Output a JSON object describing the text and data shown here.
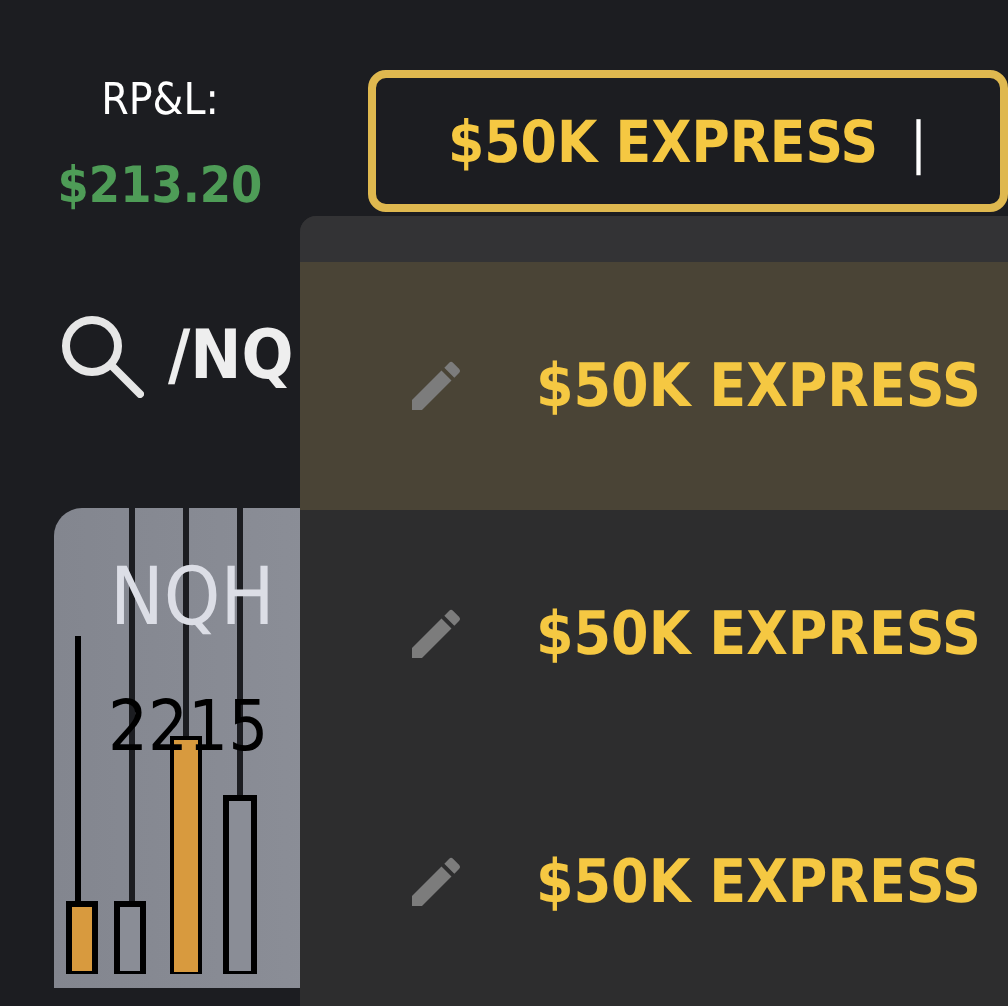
{
  "pnl": {
    "label": "RP&L:",
    "value": "$213.20"
  },
  "account_button": {
    "label": "$50K EXPRESS",
    "separator": "|"
  },
  "search": {
    "value": "/NQ"
  },
  "card": {
    "symbol": "NQH",
    "price": "2215"
  },
  "account_menu": [
    {
      "label": "$50K EXPRESS",
      "selected": true
    },
    {
      "label": "$50K EXPRESS",
      "selected": false
    },
    {
      "label": "$50K EXPRESS",
      "selected": false
    }
  ]
}
